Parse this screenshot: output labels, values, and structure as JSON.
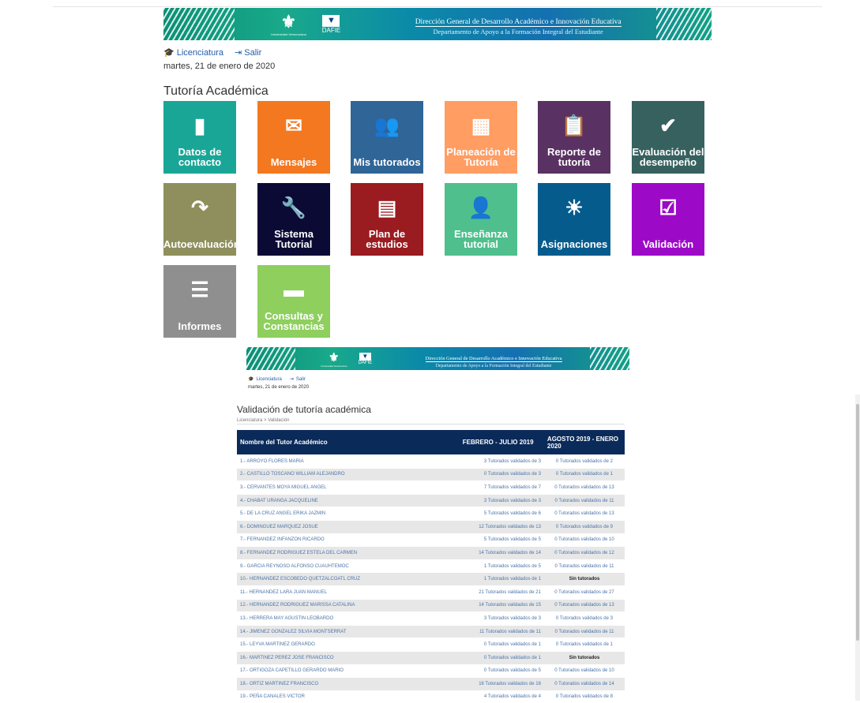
{
  "header": {
    "university": "Universidad Veracruzana",
    "dafie": "DAFIE",
    "title1": "Dirección General de Desarrollo Académico e Innovación Educativa",
    "title2": "Departamento de Apoyo a la Formación Integral del Estudiante"
  },
  "nav": {
    "licenciatura": "Licenciatura",
    "salir": "Salir"
  },
  "date": "martes, 21 de enero de 2020",
  "page_title": "Tutoría Académica",
  "tiles": [
    {
      "label": "Datos de contacto",
      "icon": "book-icon",
      "glyph": "▮",
      "color": "#1aa697"
    },
    {
      "label": "Mensajes",
      "icon": "envelope-icon",
      "glyph": "✉",
      "color": "#f4781f"
    },
    {
      "label": "Mis tutorados",
      "icon": "users-icon",
      "glyph": "👥",
      "color": "#2f6597"
    },
    {
      "label": "Planeación de Tutoría",
      "icon": "calendar-icon",
      "glyph": "▦",
      "color": "#ff9d63"
    },
    {
      "label": "Reporte de tutoría",
      "icon": "clipboard-icon",
      "glyph": "📋",
      "color": "#5a3163"
    },
    {
      "label": "Evaluación del desempeño",
      "icon": "check-icon",
      "glyph": "✔",
      "color": "#36615f"
    },
    {
      "label": "Autoevaluación",
      "icon": "redo-arrow-icon",
      "glyph": "↷",
      "color": "#8f8f5d"
    },
    {
      "label": "Sistema Tutorial",
      "icon": "wrench-icon",
      "glyph": "🔧",
      "color": "#0b0a35"
    },
    {
      "label": "Plan de estudios",
      "icon": "document-icon",
      "glyph": "▤",
      "color": "#9a1b20"
    },
    {
      "label": "Enseñanza tutorial",
      "icon": "add-user-icon",
      "glyph": "👤",
      "color": "#4fbf8e"
    },
    {
      "label": "Asignaciones",
      "icon": "sun-icon",
      "glyph": "☀",
      "color": "#065b8d"
    },
    {
      "label": "Validación",
      "icon": "checkbox-icon",
      "glyph": "☑",
      "color": "#9c0ac7"
    },
    {
      "label": "Informes",
      "icon": "list-icon",
      "glyph": "☰",
      "color": "#8f8f8f"
    },
    {
      "label": "Consultas y Constancias",
      "icon": "folder-icon",
      "glyph": "▬",
      "color": "#8ecf5e"
    }
  ],
  "panel": {
    "title": "Validación de tutoría académica",
    "breadcrumb": "Licenciatura > Validación",
    "headers": [
      "Nombre del Tutor Académico",
      "FEBRERO - JULIO 2019",
      "AGOSTO 2019 - ENERO 2020"
    ],
    "rows": [
      [
        "1.- ARROYO FLORES MARIA",
        "3 Tutorados validados de 3",
        "0 Tutorados validados de 2"
      ],
      [
        "2.- CASTILLO TOSCANO WILLIAM ALEJANDRO",
        "0 Tutorados validados de 3",
        "0 Tutorados validados de 1"
      ],
      [
        "3.- CERVANTES MOYA MIGUEL ANGEL",
        "7 Tutorados validados de 7",
        "0 Tutorados validados de 13"
      ],
      [
        "4.- CHABAT URANGA JACQUELINE",
        "3 Tutorados validados de 3",
        "0 Tutorados validados de 11"
      ],
      [
        "5.- DE LA CRUZ ANGEL ERIKA JAZMIN",
        "5 Tutorados validados de 6",
        "0 Tutorados validados de 13"
      ],
      [
        "6.- DOMINGUEZ MARQUEZ JOSUE",
        "12 Tutorados validados de 13",
        "0 Tutorados validados de 9"
      ],
      [
        "7.- FERNANDEZ INFANZON RICARDO",
        "5 Tutorados validados de 5",
        "0 Tutorados validados de 10"
      ],
      [
        "8.- FERNANDEZ RODRIGUEZ ESTELA DEL CARMEN",
        "14 Tutorados validados de 14",
        "0 Tutorados validados de 12"
      ],
      [
        "9.- GARCIA REYNOSO ALFONSO CUAUHTEMOC",
        "1 Tutorados validados de 5",
        "0 Tutorados validados de 11"
      ],
      [
        "10.- HERNANDEZ ESCOBEDO QUETZALCOATL CRUZ",
        "1 Tutorados validados de 1",
        "Sin tutorados"
      ],
      [
        "11.- HERNANDEZ LARA JUAN MANUEL",
        "21 Tutorados validados de 21",
        "0 Tutorados validados de 27"
      ],
      [
        "12.- HERNANDEZ RODRIGUEZ MARISSA CATALINA",
        "14 Tutorados validados de 15",
        "0 Tutorados validados de 13"
      ],
      [
        "13.- HERRERA MAY AGUSTIN LEOBARDO",
        "3 Tutorados validados de 3",
        "0 Tutorados validados de 3"
      ],
      [
        "14.- JIMENEZ GONZALEZ SILVIA MONTSERRAT",
        "11 Tutorados validados de 11",
        "0 Tutorados validados de 11"
      ],
      [
        "15.- LEYVA MARTINEZ GERARDO",
        "0 Tutorados validados de 1",
        "0 Tutorados validados de 1"
      ],
      [
        "16.- MARTINEZ PEREZ JOSE FRANCISCO",
        "0 Tutorados validados de 1",
        "Sin tutorados"
      ],
      [
        "17.- ORTIGOZA CAPETILLO GERARDO MARIO",
        "0 Tutorados validados de 5",
        "0 Tutorados validados de 10"
      ],
      [
        "18.- ORTIZ MARTINEZ FRANCISCO",
        "16 Tutorados validados de 16",
        "0 Tutorados validados de 14"
      ],
      [
        "19.- PEÑA CANALES VICTOR",
        "4 Tutorados validados de 4",
        "0 Tutorados validados de 8"
      ]
    ]
  }
}
